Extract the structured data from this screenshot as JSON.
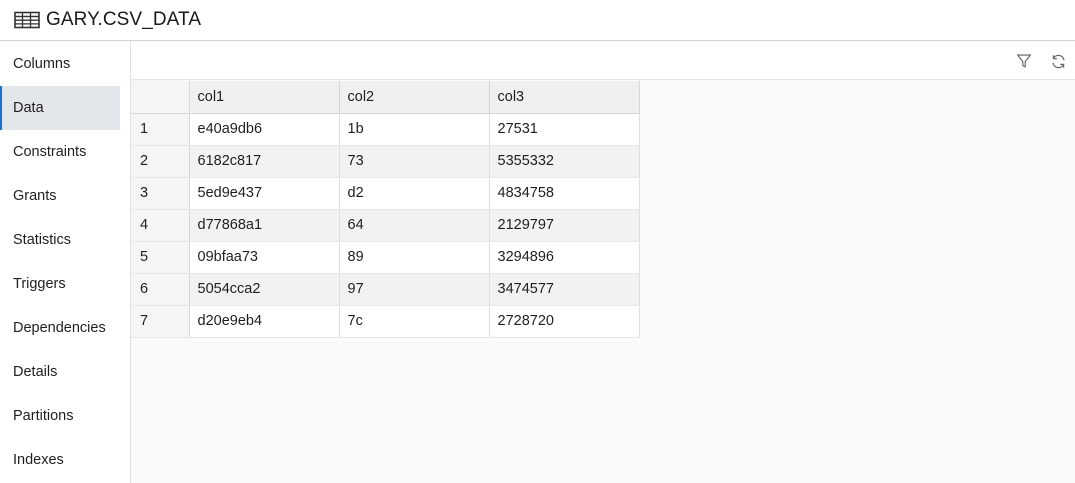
{
  "header": {
    "title": "GARY.CSV_DATA",
    "icon": "table-grid-icon"
  },
  "sidebar": {
    "items": [
      {
        "label": "Columns",
        "active": false
      },
      {
        "label": "Data",
        "active": true
      },
      {
        "label": "Constraints",
        "active": false
      },
      {
        "label": "Grants",
        "active": false
      },
      {
        "label": "Statistics",
        "active": false
      },
      {
        "label": "Triggers",
        "active": false
      },
      {
        "label": "Dependencies",
        "active": false
      },
      {
        "label": "Details",
        "active": false
      },
      {
        "label": "Partitions",
        "active": false
      },
      {
        "label": "Indexes",
        "active": false
      }
    ],
    "accent_color": "#1a73c8"
  },
  "toolbar": {
    "filter_icon": "filter-icon",
    "refresh_icon": "refresh-icon"
  },
  "grid": {
    "columns": [
      "col1",
      "col2",
      "col3"
    ],
    "rows": [
      {
        "num": "1",
        "cells": [
          "e40a9db6",
          "1b",
          "27531"
        ]
      },
      {
        "num": "2",
        "cells": [
          "6182c817",
          "73",
          "5355332"
        ]
      },
      {
        "num": "3",
        "cells": [
          "5ed9e437",
          "d2",
          "4834758"
        ]
      },
      {
        "num": "4",
        "cells": [
          "d77868a1",
          "64",
          "2129797"
        ]
      },
      {
        "num": "5",
        "cells": [
          "09bfaa73",
          "89",
          "3294896"
        ]
      },
      {
        "num": "6",
        "cells": [
          "5054cca2",
          "97",
          "3474577"
        ]
      },
      {
        "num": "7",
        "cells": [
          "d20e9eb4",
          "7c",
          "2728720"
        ]
      }
    ]
  }
}
